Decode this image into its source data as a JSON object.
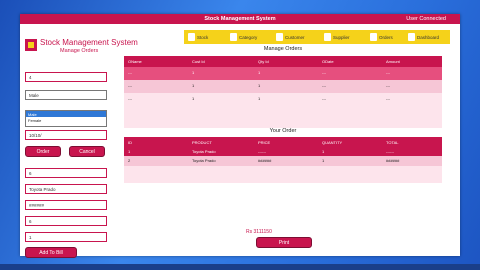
{
  "window": {
    "title": "Stock Management System",
    "user": "User Connected"
  },
  "brand": {
    "title": "Stock Management System",
    "subtitle": "Manage Orders"
  },
  "nav": [
    {
      "label": "Stock",
      "icon": "stock-icon"
    },
    {
      "label": "Category",
      "icon": "category-icon"
    },
    {
      "label": "Customer",
      "icon": "customer-icon"
    },
    {
      "label": "Supplier",
      "icon": "supplier-icon"
    },
    {
      "label": "Orders",
      "icon": "orders-icon"
    },
    {
      "label": "Dashboard",
      "icon": "dashboard-icon"
    }
  ],
  "manage_orders": {
    "title": "Manage Orders",
    "headers": [
      "OName",
      "Cust Id",
      "Qty Id",
      "ODate",
      "Amount"
    ],
    "rows": [
      [
        "---",
        "1",
        "1",
        "---",
        "---"
      ],
      [
        "---",
        "1",
        "1",
        "---",
        "---"
      ],
      [
        "---",
        "1",
        "1",
        "---",
        "---"
      ]
    ]
  },
  "your_order": {
    "title": "Your Order",
    "headers": [
      "ID",
      "PRODUCT",
      "PRICE",
      "QUANTITY",
      "TOTAL"
    ],
    "rows": [
      [
        "1",
        "Toyota Prado",
        "------",
        "1",
        "------"
      ],
      [
        "2",
        "Toyota Prado",
        "######",
        "1",
        "######"
      ]
    ]
  },
  "form": {
    "field1": "4",
    "gender_selected": "Male",
    "gender_options": [
      "Male",
      "Female"
    ],
    "field3": "10/10/",
    "order_btn": "Order",
    "cancel_btn": "Cancel",
    "product_select": "6",
    "product_name": "Toyota Prado",
    "price": "######",
    "qty_display": "6",
    "qty": "1",
    "add_btn": "Add To Bill"
  },
  "total": {
    "label": "Rs 3111150"
  },
  "print_btn": "Print"
}
